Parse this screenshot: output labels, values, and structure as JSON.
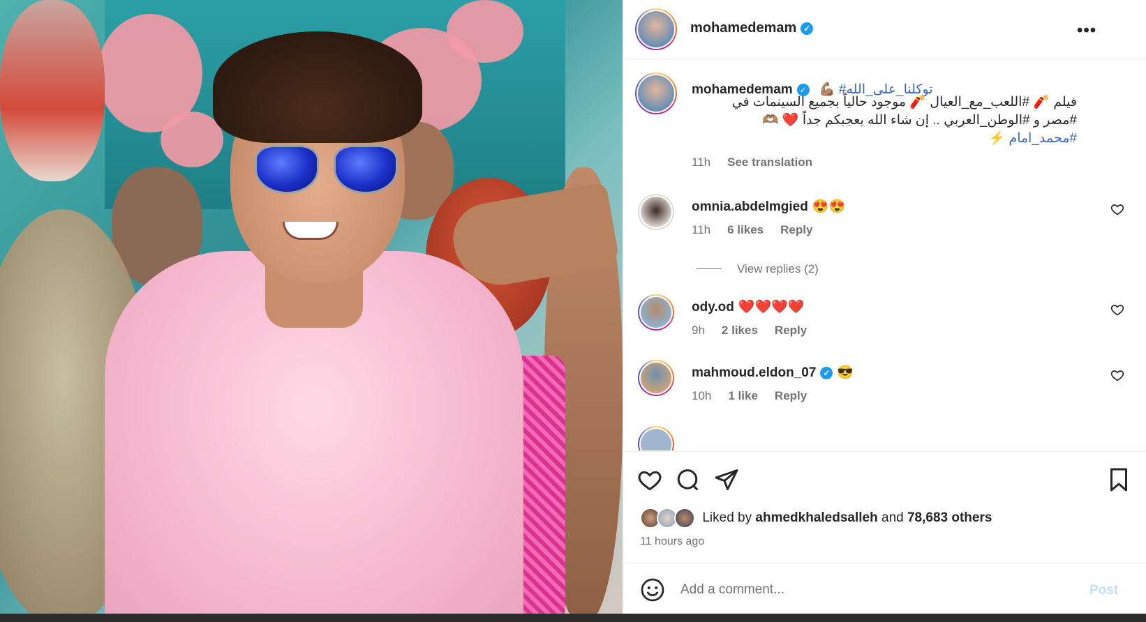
{
  "post": {
    "username": "mohamedemam",
    "more_label": "•••"
  },
  "caption": {
    "username": "mohamedemam",
    "line1_tag": "#توكلنا_على_الله",
    "line1_emoji": "💪🏽",
    "line2": "فيلم 🧨 #اللعب_مع_العيال 🧨 موجود حالياً بجميع السينمات في",
    "line3": "#مصر و #الوطن_العربي .. إن شاء الله يعجبكم جداً ❤️ 🫶🏽",
    "line4": "#محمد_امام ⚡",
    "time": "11h",
    "see_translation": "See translation"
  },
  "comments": [
    {
      "username": "omnia.abdelmgied",
      "text": "😍😍",
      "time": "11h",
      "likes": "6 likes",
      "reply": "Reply",
      "verified": false
    },
    {
      "username": "ody.od",
      "text": "❤️❤️❤️❤️",
      "time": "9h",
      "likes": "2 likes",
      "reply": "Reply",
      "verified": false
    },
    {
      "username": "mahmoud.eldon_07",
      "text": "😎",
      "time": "10h",
      "likes": "1 like",
      "reply": "Reply",
      "verified": true
    }
  ],
  "view_replies": "View replies (2)",
  "likes": {
    "prefix": "Liked by",
    "user": "ahmedkhaledsalleh",
    "connector": "and",
    "others": "78,683 others"
  },
  "time_ago": "11 hours ago",
  "add_comment": {
    "placeholder": "Add a comment...",
    "post_label": "Post"
  }
}
